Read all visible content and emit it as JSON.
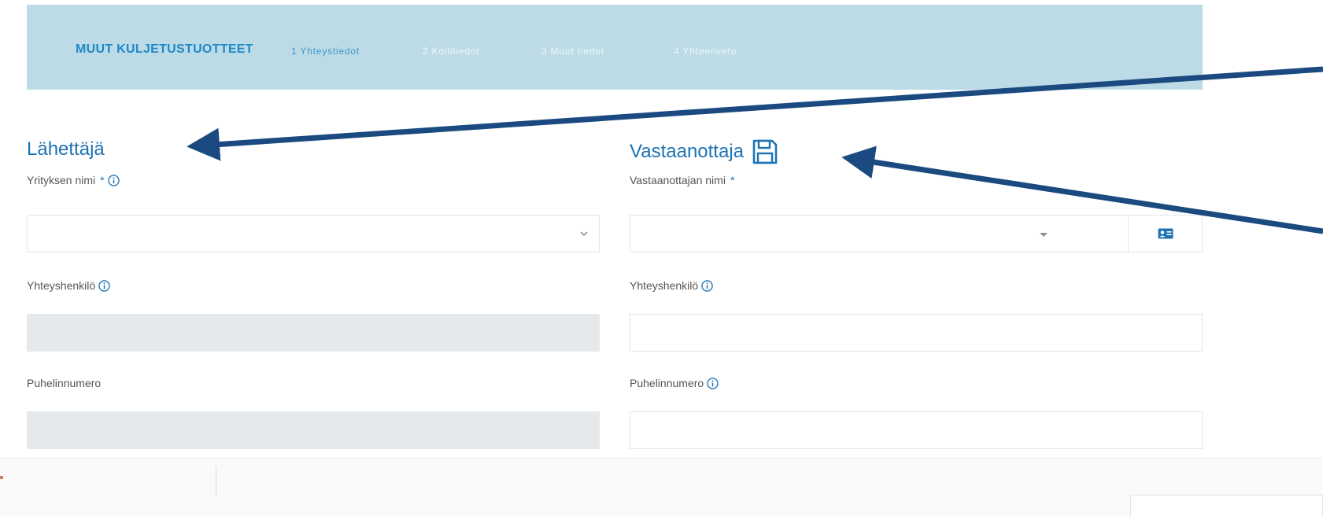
{
  "stepper": {
    "product": "MUUT KULJETUSTUOTTEET",
    "steps": [
      {
        "label": "1 Yhteystiedot"
      },
      {
        "label": "2 Kollitiedot"
      },
      {
        "label": "3 Muut tiedot"
      },
      {
        "label": "4 Yhteenveto"
      }
    ],
    "active_step": 1
  },
  "sender": {
    "title": "Lähettäjä",
    "company_name": {
      "label": "Yrityksen nimi",
      "required_mark": "*",
      "value": ""
    },
    "contact_person": {
      "label": "Yhteyshenkilö",
      "value": ""
    },
    "phone": {
      "label": "Puhelinnumero",
      "value": ""
    }
  },
  "recipient": {
    "title": "Vastaanottaja",
    "recipient_name": {
      "label": "Vastaanottajan nimi",
      "required_mark": "*",
      "value": ""
    },
    "contact_person": {
      "label": "Yhteyshenkilö",
      "value": ""
    },
    "phone": {
      "label": "Puhelinnumero",
      "value": ""
    }
  },
  "icons": {
    "info": "info-icon",
    "save": "save-icon",
    "contact_card": "contact-card-icon",
    "chevron": "chevron-down-icon"
  },
  "colors": {
    "banner": "#bcdbe6",
    "brand_blue": "#1c72b3",
    "arrow": "#1a4a80",
    "disabled_field": "#e6e9eb"
  }
}
